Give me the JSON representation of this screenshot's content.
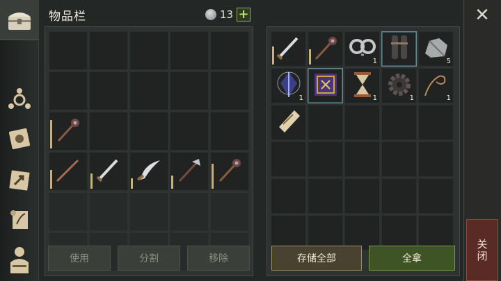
{
  "header": {
    "title": "物品栏",
    "coin_count": "13",
    "add_label": "+"
  },
  "sidebar": {
    "icons": [
      "chest-icon",
      "crafting-icon",
      "journal-icon",
      "map-icon",
      "quest-scroll-icon",
      "character-icon"
    ]
  },
  "left_grid": {
    "rows": 6,
    "cols": 5,
    "items": [
      {
        "index": 10,
        "icon": "mace-icon",
        "count": "",
        "durability": 0.85
      },
      {
        "index": 15,
        "icon": "spear-icon",
        "count": "",
        "durability": 0.55
      },
      {
        "index": 16,
        "icon": "sword-icon",
        "count": "",
        "durability": 0.45
      },
      {
        "index": 17,
        "icon": "scimitar-icon",
        "count": "",
        "durability": 0.3
      },
      {
        "index": 18,
        "icon": "halberd-icon",
        "count": "",
        "durability": 0.4
      },
      {
        "index": 19,
        "icon": "mace-icon",
        "count": "",
        "durability": 0.75
      }
    ]
  },
  "left_buttons": {
    "use": "使用",
    "split": "分割",
    "remove": "移除"
  },
  "right_grid": {
    "rows": 6,
    "cols": 5,
    "items": [
      {
        "index": 0,
        "icon": "sword-icon",
        "count": "",
        "durability": 0.6
      },
      {
        "index": 1,
        "icon": "mace-icon",
        "count": "",
        "durability": 0.5
      },
      {
        "index": 2,
        "icon": "shackles-icon",
        "count": "1",
        "durability": null
      },
      {
        "index": 3,
        "icon": "leg-armor-icon",
        "count": "",
        "durability": null,
        "highlighted": true
      },
      {
        "index": 4,
        "icon": "stone-ore-icon",
        "count": "5",
        "durability": null
      },
      {
        "index": 5,
        "icon": "crystal-icon",
        "count": "1",
        "durability": null
      },
      {
        "index": 6,
        "icon": "rune-book-icon",
        "count": "",
        "durability": null,
        "highlighted": true
      },
      {
        "index": 7,
        "icon": "hourglass-icon",
        "count": "1",
        "durability": null
      },
      {
        "index": 8,
        "icon": "gear-icon",
        "count": "1",
        "durability": null
      },
      {
        "index": 9,
        "icon": "rope-icon",
        "count": "1",
        "durability": null
      },
      {
        "index": 10,
        "icon": "scroll-icon",
        "count": "",
        "durability": null
      }
    ]
  },
  "right_buttons": {
    "store_all": "存储全部",
    "take_all": "全拿"
  },
  "close": {
    "label": "关闭"
  }
}
